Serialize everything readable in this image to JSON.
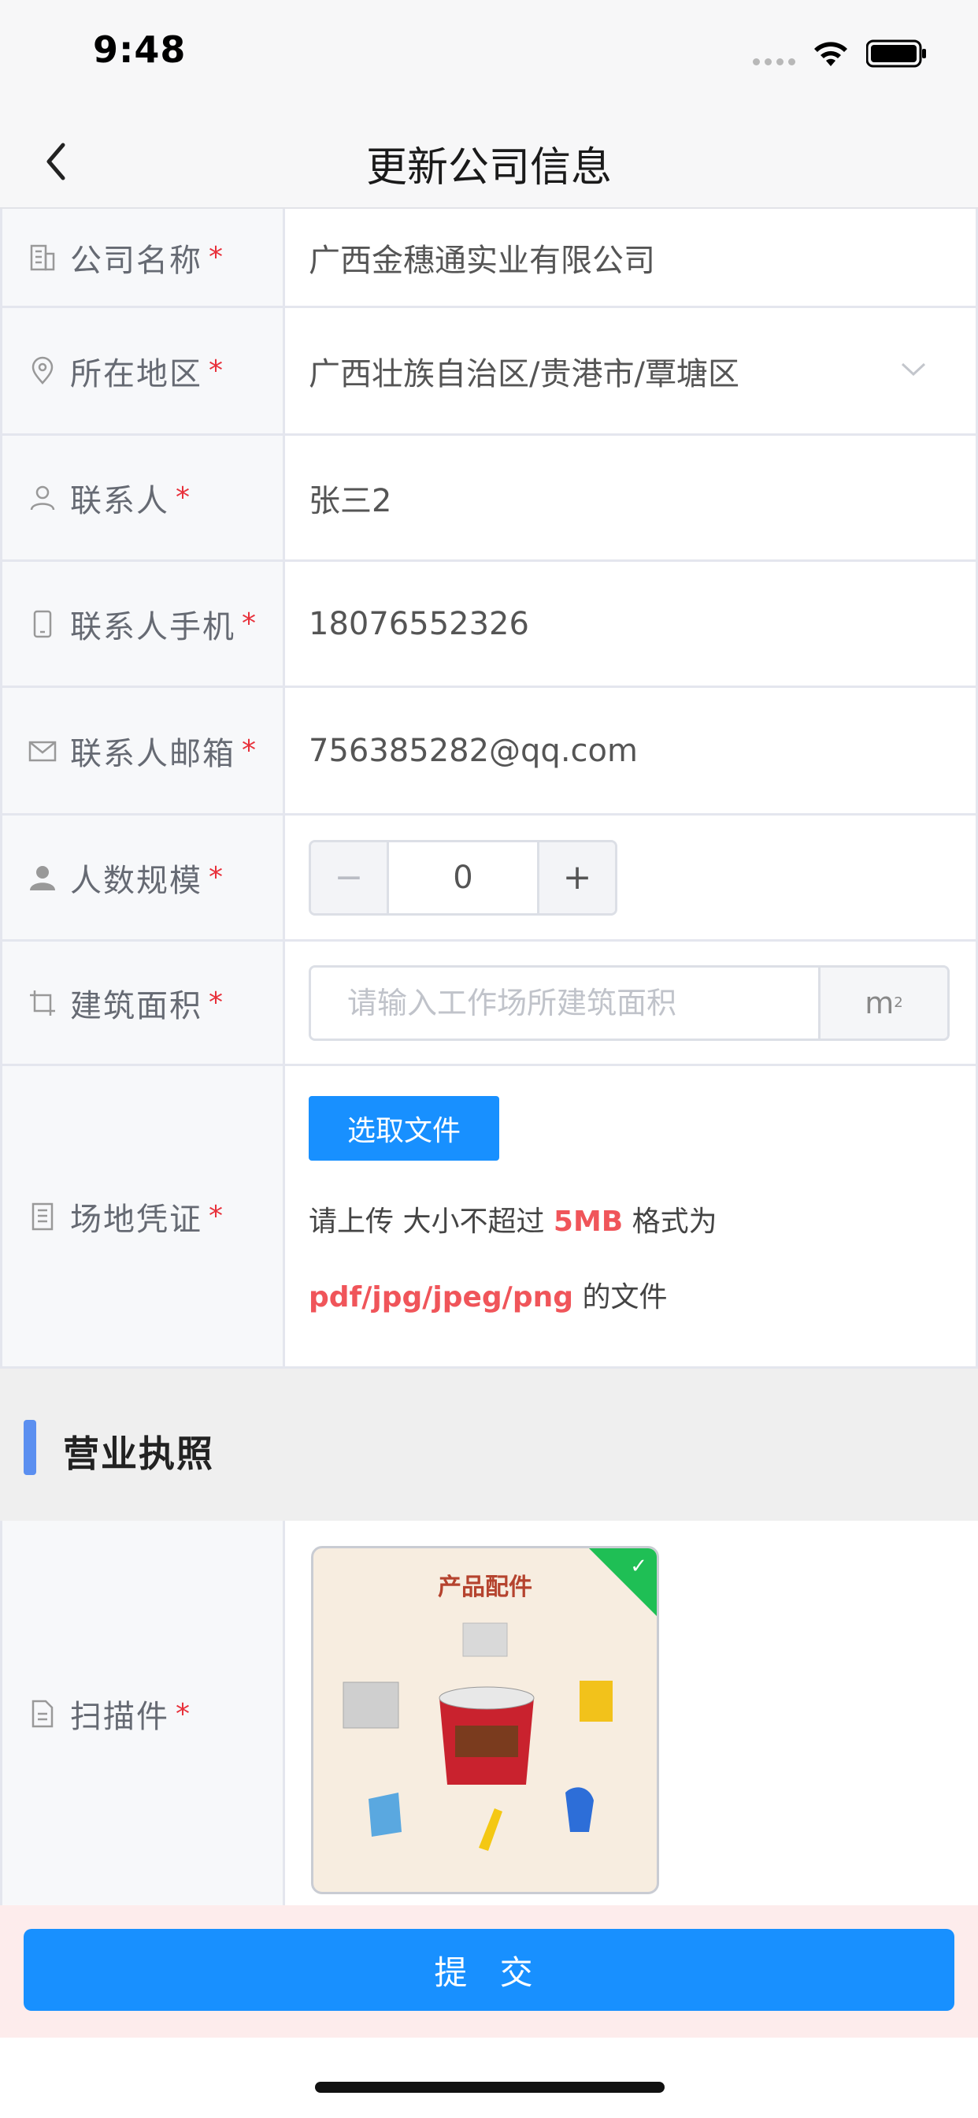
{
  "status_bar": {
    "time": "9:48"
  },
  "nav": {
    "title": "更新公司信息"
  },
  "form": {
    "company_name": {
      "label": "公司名称",
      "required": "*",
      "value": "广西金穗通实业有限公司"
    },
    "region": {
      "label": "所在地区",
      "required": "*",
      "value": "广西壮族自治区/贵港市/覃塘区"
    },
    "contact": {
      "label": "联系人",
      "required": "*",
      "value": "张三2"
    },
    "phone": {
      "label": "联系人手机",
      "required": "*",
      "value": "18076552326"
    },
    "email": {
      "label": "联系人邮箱",
      "required": "*",
      "value": "756385282@qq.com"
    },
    "staff_size": {
      "label": "人数规模",
      "required": "*",
      "value": "0",
      "minus": "−",
      "plus": "+"
    },
    "building_area": {
      "label": "建筑面积",
      "required": "*",
      "placeholder": "请输入工作场所建筑面积",
      "unit": "m"
    },
    "site_proof": {
      "label": "场地凭证",
      "required": "*",
      "button": "选取文件",
      "hint_prefix": "请上传 大小不超过 ",
      "hint_size": "5MB",
      "hint_mid": " 格式为 ",
      "hint_formats": "pdf/jpg/jpeg/png",
      "hint_suffix": " 的文件"
    }
  },
  "business_license": {
    "section_title": "营业执照",
    "scan": {
      "label": "扫描件",
      "required": "*",
      "thumb_title": "产品配件",
      "check": "✓"
    }
  },
  "footer": {
    "submit": "提 交"
  },
  "colors": {
    "primary": "#1890ff",
    "required": "#e8313b",
    "accent_bar": "#5b8ff0",
    "success": "#1fbf55"
  }
}
